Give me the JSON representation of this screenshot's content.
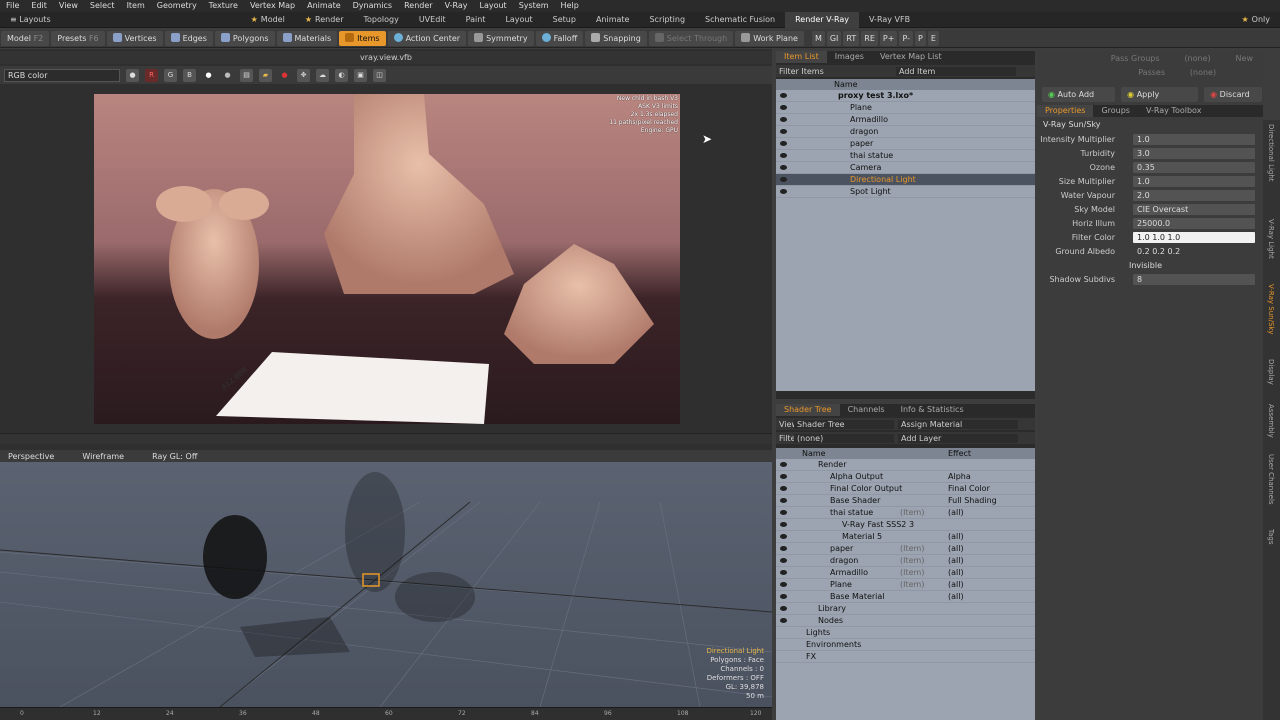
{
  "menu": [
    "File",
    "Edit",
    "View",
    "Select",
    "Item",
    "Geometry",
    "Texture",
    "Vertex Map",
    "Animate",
    "Dynamics",
    "Render",
    "V-Ray",
    "Layout",
    "System",
    "Help"
  ],
  "layoutbar": {
    "label": "Layouts",
    "tabs": [
      "Model",
      "Render",
      "Topology",
      "UVEdit",
      "Paint",
      "Layout",
      "Setup",
      "Animate",
      "Scripting",
      "Schematic Fusion",
      "Render V-Ray",
      "V-Ray VFB"
    ],
    "active": "Render V-Ray",
    "only_label": "Only"
  },
  "toolbar": {
    "model": "Model",
    "f2": "F2",
    "presets": "Presets",
    "f6": "F6",
    "vertices": "Vertices",
    "edges": "Edges",
    "polygons": "Polygons",
    "materials": "Materials",
    "items": "Items",
    "action_center": "Action Center",
    "symmetry": "Symmetry",
    "falloff": "Falloff",
    "snapping": "Snapping",
    "select_through": "Select Through",
    "work_plane": "Work Plane",
    "right_labels": [
      "M",
      "GI",
      "RT",
      "RE",
      "P+",
      "P-",
      "P",
      "E"
    ]
  },
  "vfb": {
    "title": "vray.view.vfb",
    "channel": "RGB color",
    "overlay": [
      "New chld in bash V3",
      "ASK V3 limits",
      "2x 1.3s elapsed",
      "11 paths/pixel reached",
      "Engine: GPU"
    ],
    "paper_text": "A1Z BBB",
    "channel_buttons": [
      "R",
      "G",
      "B"
    ]
  },
  "viewport": {
    "labels": [
      "Perspective",
      "Wireframe",
      "Ray GL: Off"
    ],
    "info": [
      "Directional Light",
      "Polygons : Face",
      "Channels : 0",
      "Deformers : OFF",
      "GL: 39,878",
      "50 m"
    ]
  },
  "ruler": [
    "0",
    "12",
    "24",
    "36",
    "48",
    "60",
    "72",
    "84",
    "96",
    "108",
    "120"
  ],
  "itemlist": {
    "tabs": [
      "Item List",
      "Images",
      "Vertex Map List"
    ],
    "filter": "Filter Items",
    "add_item": "Add Item",
    "col": "Name",
    "items": [
      {
        "name": "proxy test 3.lxo*",
        "indent": 0,
        "bold": true
      },
      {
        "name": "Plane",
        "indent": 1
      },
      {
        "name": "Armadillo",
        "indent": 1
      },
      {
        "name": "dragon",
        "indent": 1
      },
      {
        "name": "paper",
        "indent": 1
      },
      {
        "name": "thai statue",
        "indent": 1
      },
      {
        "name": "Camera",
        "indent": 1
      },
      {
        "name": "Directional Light",
        "indent": 1,
        "sel": true
      },
      {
        "name": "Spot Light",
        "indent": 1
      }
    ]
  },
  "shader": {
    "tabs": [
      "Shader Tree",
      "Channels",
      "Info & Statistics"
    ],
    "view_label": "View",
    "view_value": "Shader Tree",
    "assign": "Assign Material",
    "filter_label": "Filter",
    "filter_value": "(none)",
    "add_layer": "Add Layer",
    "col_name": "Name",
    "col_effect": "Effect",
    "rows": [
      {
        "name": "Render",
        "effect": "",
        "indent": 0
      },
      {
        "name": "Alpha Output",
        "effect": "Alpha",
        "indent": 1
      },
      {
        "name": "Final Color Output",
        "effect": "Final Color",
        "indent": 1
      },
      {
        "name": "Base Shader",
        "effect": "Full Shading",
        "indent": 1
      },
      {
        "name": "thai statue",
        "tag": "(Item)",
        "effect": "(all)",
        "indent": 1
      },
      {
        "name": "V-Ray Fast SSS2 3",
        "effect": "",
        "indent": 2
      },
      {
        "name": "Material 5",
        "effect": "(all)",
        "indent": 2
      },
      {
        "name": "paper",
        "tag": "(Item)",
        "effect": "(all)",
        "indent": 1
      },
      {
        "name": "dragon",
        "tag": "(Item)",
        "effect": "(all)",
        "indent": 1
      },
      {
        "name": "Armadillo",
        "tag": "(Item)",
        "effect": "(all)",
        "indent": 1
      },
      {
        "name": "Plane",
        "tag": "(Item)",
        "effect": "(all)",
        "indent": 1
      },
      {
        "name": "Base Material",
        "effect": "(all)",
        "indent": 1
      },
      {
        "name": "Library",
        "effect": "",
        "indent": 0
      },
      {
        "name": "Nodes",
        "effect": "",
        "indent": 0
      },
      {
        "name": "Lights",
        "effect": "",
        "indent": -1
      },
      {
        "name": "Environments",
        "effect": "",
        "indent": -1
      },
      {
        "name": "FX",
        "effect": "",
        "indent": -1
      }
    ]
  },
  "props": {
    "pass_groups": "Pass Groups",
    "passes": "Passes",
    "none": "(none)",
    "new": "New",
    "auto_add": "Auto Add",
    "apply": "Apply",
    "discard": "Discard",
    "tabs": [
      "Properties",
      "Groups",
      "V-Ray Toolbox"
    ],
    "section": "V-Ray Sun/Sky",
    "fields": [
      {
        "label": "Intensity Multiplier",
        "value": "1.0"
      },
      {
        "label": "Turbidity",
        "value": "3.0"
      },
      {
        "label": "Ozone",
        "value": "0.35"
      },
      {
        "label": "Size Multiplier",
        "value": "1.0"
      },
      {
        "label": "Water Vapour",
        "value": "2.0"
      },
      {
        "label": "Sky Model",
        "value": "CIE Overcast"
      },
      {
        "label": "Horiz Illum",
        "value": "25000.0"
      },
      {
        "label": "Filter Color",
        "value": "1.0          1.0          1.0",
        "white": true
      },
      {
        "label": "Ground Albedo",
        "value": "0.2          0.2          0.2",
        "flat": true
      },
      {
        "label": "",
        "value": "Invisible",
        "check": true
      },
      {
        "label": "Shadow Subdivs",
        "value": "8"
      }
    ],
    "sidetabs": [
      "Directional Light",
      "V-Ray Light",
      "V-Ray Sun/Sky",
      "Display",
      "Assembly",
      "User Channels",
      "Tags"
    ]
  }
}
